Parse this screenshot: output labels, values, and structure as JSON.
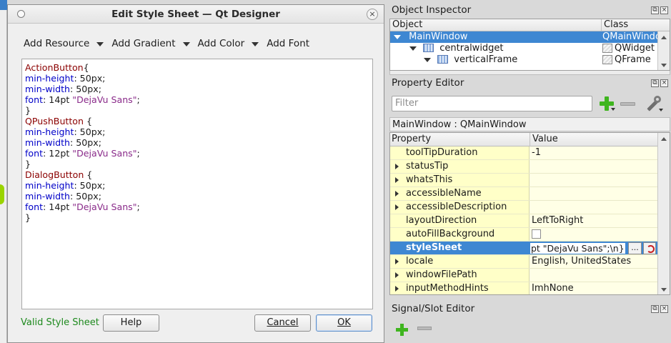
{
  "dialog": {
    "title": "Edit Style Sheet — Qt Designer",
    "close_glyph": "×",
    "toolbar": [
      {
        "label": "Add Resource",
        "has_menu": true
      },
      {
        "label": "Add Gradient",
        "has_menu": true
      },
      {
        "label": "Add Color",
        "has_menu": true
      },
      {
        "label": "Add Font",
        "has_menu": false
      }
    ],
    "editor_lines": [
      [
        {
          "t": "ActionButton",
          "c": "sel"
        },
        {
          "t": "{",
          "c": "plain"
        }
      ],
      [
        {
          "t": "min-height",
          "c": "prop"
        },
        {
          "t": ": 50px;",
          "c": "plain"
        }
      ],
      [
        {
          "t": "min-width",
          "c": "prop"
        },
        {
          "t": ": 50px;",
          "c": "plain"
        }
      ],
      [
        {
          "t": "font",
          "c": "prop"
        },
        {
          "t": ": 14pt ",
          "c": "plain"
        },
        {
          "t": "\"DejaVu Sans\"",
          "c": "str"
        },
        {
          "t": ";",
          "c": "plain"
        }
      ],
      [
        {
          "t": "}",
          "c": "plain"
        }
      ],
      [
        {
          "t": "QPushButton",
          "c": "sel"
        },
        {
          "t": " {",
          "c": "plain"
        }
      ],
      [
        {
          "t": "min-height",
          "c": "prop"
        },
        {
          "t": ": 50px;",
          "c": "plain"
        }
      ],
      [
        {
          "t": "min-width",
          "c": "prop"
        },
        {
          "t": ": 50px;",
          "c": "plain"
        }
      ],
      [
        {
          "t": "font",
          "c": "prop"
        },
        {
          "t": ": 12pt ",
          "c": "plain"
        },
        {
          "t": "\"DejaVu Sans\"",
          "c": "str"
        },
        {
          "t": ";",
          "c": "plain"
        }
      ],
      [
        {
          "t": "}",
          "c": "plain"
        }
      ],
      [
        {
          "t": "DialogButton",
          "c": "sel"
        },
        {
          "t": " {",
          "c": "plain"
        }
      ],
      [
        {
          "t": "min-height",
          "c": "prop"
        },
        {
          "t": ": 50px;",
          "c": "plain"
        }
      ],
      [
        {
          "t": "min-width",
          "c": "prop"
        },
        {
          "t": ": 50px;",
          "c": "plain"
        }
      ],
      [
        {
          "t": "font",
          "c": "prop"
        },
        {
          "t": ": 14pt ",
          "c": "plain"
        },
        {
          "t": "\"DejaVu Sans\"",
          "c": "str"
        },
        {
          "t": ";",
          "c": "plain"
        }
      ],
      [
        {
          "t": "}",
          "c": "plain"
        }
      ]
    ],
    "status": "Valid Style Sheet",
    "help_label": "Help",
    "cancel_label": "Cancel",
    "ok_label": "OK"
  },
  "object_inspector": {
    "title": "Object Inspector",
    "col_object": "Object",
    "col_class": "Class",
    "rows": [
      {
        "name": "MainWindow",
        "class": "QMainWindo",
        "indent": 0,
        "selected": true
      },
      {
        "name": "centralwidget",
        "class": "QWidget",
        "indent": 1,
        "selected": false
      },
      {
        "name": "verticalFrame",
        "class": "QFrame",
        "indent": 2,
        "selected": false
      }
    ]
  },
  "property_editor": {
    "title": "Property Editor",
    "filter_placeholder": "Filter",
    "context": "MainWindow : QMainWindow",
    "col_property": "Property",
    "col_value": "Value",
    "rows": [
      {
        "name": "toolTipDuration",
        "value": "-1",
        "expandable": false
      },
      {
        "name": "statusTip",
        "value": "",
        "expandable": true
      },
      {
        "name": "whatsThis",
        "value": "",
        "expandable": true
      },
      {
        "name": "accessibleName",
        "value": "",
        "expandable": true
      },
      {
        "name": "accessibleDescription",
        "value": "",
        "expandable": true
      },
      {
        "name": "layoutDirection",
        "value": "LeftToRight",
        "expandable": false
      },
      {
        "name": "autoFillBackground",
        "value": "",
        "expandable": false,
        "checkbox": true
      },
      {
        "name": "styleSheet",
        "value": "pt \"DejaVu Sans\";\\n}",
        "expandable": false,
        "selected": true
      },
      {
        "name": "locale",
        "value": "English, UnitedStates",
        "expandable": true
      },
      {
        "name": "windowFilePath",
        "value": "",
        "expandable": true
      },
      {
        "name": "inputMethodHints",
        "value": "ImhNone",
        "expandable": true
      }
    ],
    "dots_label": "..."
  },
  "signal_slot_editor": {
    "title": "Signal/Slot Editor"
  },
  "panel_controls": [
    "⧉",
    "×"
  ]
}
